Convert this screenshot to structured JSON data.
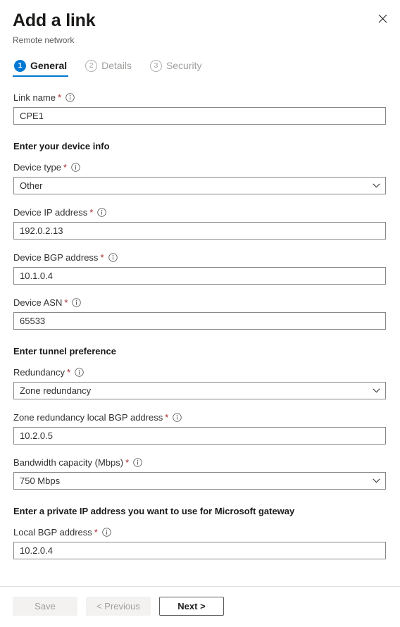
{
  "header": {
    "title": "Add a link",
    "subtitle": "Remote network",
    "close_label": "Close"
  },
  "tabs": [
    {
      "number": "1",
      "label": "General",
      "active": true
    },
    {
      "number": "2",
      "label": "Details",
      "active": false
    },
    {
      "number": "3",
      "label": "Security",
      "active": false
    }
  ],
  "form": {
    "link_name": {
      "label": "Link name",
      "required": "*",
      "value": "CPE1",
      "placeholder": ""
    },
    "device_section": {
      "heading": "Enter your device info"
    },
    "device_type": {
      "label": "Device type",
      "required": "*",
      "value": "Other"
    },
    "device_ip": {
      "label": "Device IP address",
      "required": "*",
      "value": "192.0.2.13",
      "placeholder": ""
    },
    "device_bgp": {
      "label": "Device BGP address",
      "required": "*",
      "value": "10.1.0.4",
      "placeholder": ""
    },
    "device_asn": {
      "label": "Device ASN",
      "required": "*",
      "value": "65533",
      "placeholder": ""
    },
    "tunnel_section": {
      "heading": "Enter tunnel preference"
    },
    "redundancy": {
      "label": "Redundancy",
      "required": "*",
      "value": "Zone redundancy"
    },
    "zone_redundancy_bgp": {
      "label": "Zone redundancy local BGP address",
      "required": "*",
      "value": "10.2.0.5",
      "placeholder": ""
    },
    "bandwidth": {
      "label": "Bandwidth capacity (Mbps)",
      "required": "*",
      "value": "750 Mbps"
    },
    "gateway_section": {
      "heading": "Enter a private IP address you want to use for Microsoft gateway"
    },
    "local_bgp": {
      "label": "Local BGP address",
      "required": "*",
      "value": "10.2.0.4",
      "placeholder": ""
    }
  },
  "footer": {
    "save_label": "Save",
    "previous_label": "< Previous",
    "next_label": "Next >"
  },
  "colors": {
    "accent": "#0078d4",
    "required_asterisk": "#a4262c",
    "border": "#8a8886",
    "disabled_text": "#a19f9d"
  }
}
